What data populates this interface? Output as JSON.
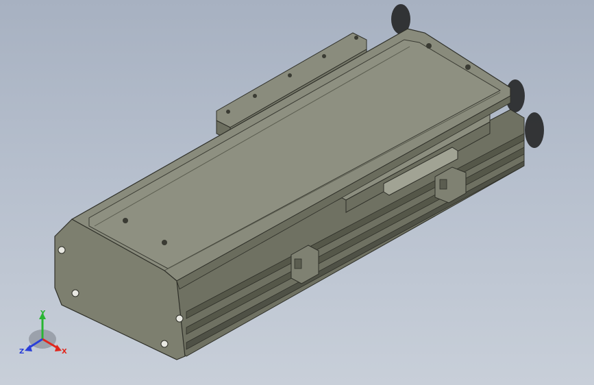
{
  "viewport": {
    "background_top": "#a7b1c1",
    "background_bottom": "#c8cfd9",
    "model": "linear-actuator-module"
  },
  "triad": {
    "x_label": "X",
    "y_label": "Y",
    "z_label": "Z",
    "x_color": "#e0261c",
    "y_color": "#29b533",
    "z_color": "#2a3fd8"
  },
  "model_colors": {
    "top": "#87897a",
    "side": "#6d6f60",
    "front": "#7b7d6d",
    "dark": "#4f5146",
    "edge": "#2e2f28",
    "motor": "#1d1d1d"
  }
}
